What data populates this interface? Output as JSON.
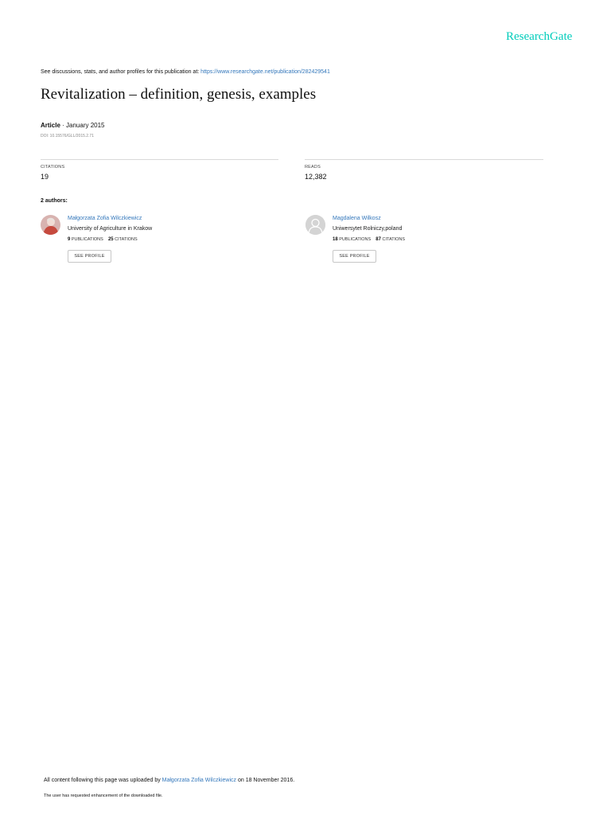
{
  "brand": "ResearchGate",
  "intro": {
    "text": "See discussions, stats, and author profiles for this publication at: ",
    "link": "https://www.researchgate.net/publication/282429541"
  },
  "publication": {
    "title": "Revitalization – definition, genesis, examples",
    "type": "Article",
    "date": "· January 2015",
    "doi": "DOI: 10.15576/GLL/2015.2.71"
  },
  "stats": {
    "citations_label": "CITATIONS",
    "citations_value": "19",
    "reads_label": "READS",
    "reads_value": "12,382"
  },
  "authors_heading": "2 authors:",
  "authors": [
    {
      "name": "Małgorzata Zofia Wilczkiewicz",
      "institution": "University of Agriculture in Krakow",
      "publications_count": "9",
      "publications_label": "PUBLICATIONS",
      "citations_count": "25",
      "citations_label": "CITATIONS",
      "button": "SEE PROFILE"
    },
    {
      "name": "Magdalena Wilkosz",
      "institution": "Uniwersytet Rolniczy,poland",
      "publications_count": "18",
      "publications_label": "PUBLICATIONS",
      "citations_count": "87",
      "citations_label": "CITATIONS",
      "button": "SEE PROFILE"
    }
  ],
  "footer": {
    "uploaded_prefix": "All content following this page was uploaded by ",
    "uploader": "Małgorzata Zofia Wilczkiewicz",
    "uploaded_suffix": " on 18 November 2016.",
    "note": "The user has requested enhancement of the downloaded file."
  },
  "colors": {
    "brand": "#00ccbb",
    "link": "#3377bb"
  }
}
